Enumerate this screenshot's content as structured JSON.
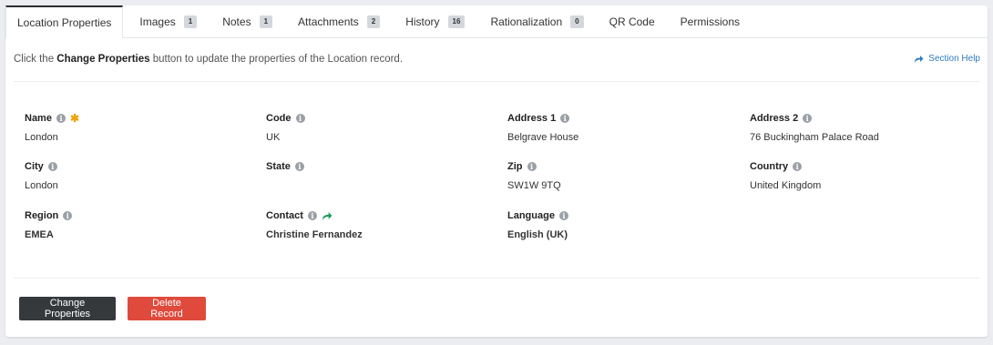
{
  "tabs": [
    {
      "label": "Location Properties",
      "badge": null,
      "active": true
    },
    {
      "label": "Images",
      "badge": "1"
    },
    {
      "label": "Notes",
      "badge": "1"
    },
    {
      "label": "Attachments",
      "badge": "2"
    },
    {
      "label": "History",
      "badge": "16"
    },
    {
      "label": "Rationalization",
      "badge": "0"
    },
    {
      "label": "QR Code",
      "badge": null
    },
    {
      "label": "Permissions",
      "badge": null
    }
  ],
  "info": {
    "prefix": "Click the ",
    "bold": "Change Properties",
    "suffix": " button to update the properties of the Location record."
  },
  "help": {
    "label": "Section Help",
    "color": "#2e7cc2"
  },
  "fields": {
    "name": {
      "label": "Name",
      "value": "London",
      "required": true
    },
    "code": {
      "label": "Code",
      "value": "UK"
    },
    "address1": {
      "label": "Address 1",
      "value": "Belgrave House"
    },
    "address2": {
      "label": "Address 2",
      "value": "76 Buckingham Palace Road"
    },
    "city": {
      "label": "City",
      "value": "London"
    },
    "state": {
      "label": "State",
      "value": ""
    },
    "zip": {
      "label": "Zip",
      "value": "SW1W 9TQ"
    },
    "country": {
      "label": "Country",
      "value": "United Kingdom"
    },
    "region": {
      "label": "Region",
      "value": "EMEA"
    },
    "contact": {
      "label": "Contact",
      "value": "Christine Fernandez"
    },
    "language": {
      "label": "Language",
      "value": "English (UK)"
    }
  },
  "buttons": {
    "change": {
      "label": "Change Properties",
      "color": "#35393c"
    },
    "delete": {
      "label": "Delete Record",
      "color": "#e04a3c"
    }
  },
  "colors": {
    "required_star": "#f0a30a",
    "contact_link": "#1a9a5a"
  }
}
